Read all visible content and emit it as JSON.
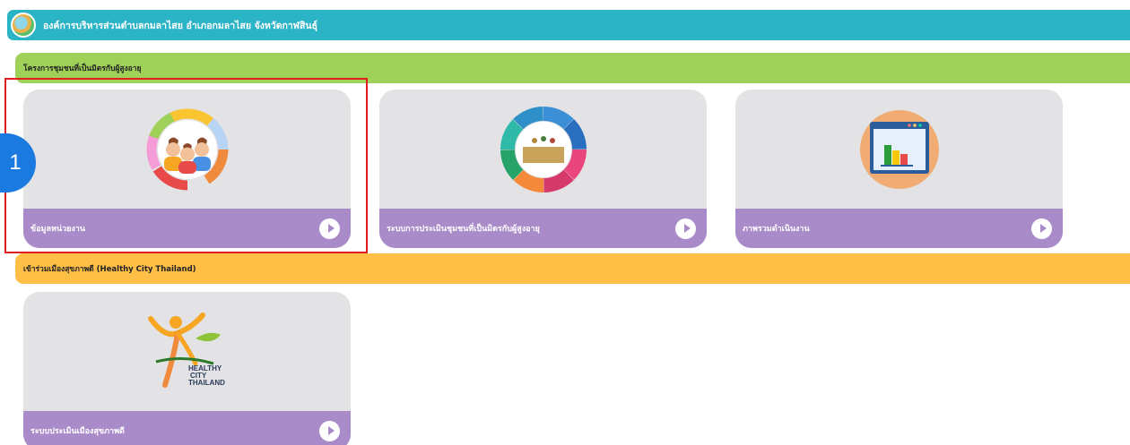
{
  "header": {
    "logo_icon": "municipality-seal-icon",
    "title": "องค์การบริหารส่วนตำบลกมลาไสย อำเภอกมลาไสย จังหวัดกาฬสินธุ์"
  },
  "sections": [
    {
      "title": "โครงการชุมชนที่เป็นมิตรกับผู้สูงอายุ",
      "color": "#9fd159",
      "cards": [
        {
          "label": "ข้อมูลหน่วยงาน",
          "icon": "people-group-icon"
        },
        {
          "label": "ระบบการประเมินชุมชนที่เป็นมิตรกับผู้สูงอายุ",
          "icon": "assessment-wheel-icon"
        },
        {
          "label": "ภาพรวมดำเนินงาน",
          "icon": "bar-chart-window-icon"
        }
      ]
    },
    {
      "title": "เข้าร่วมเมืองสุขภาพดี (Healthy City Thailand)",
      "color": "#ffbf47",
      "cards": [
        {
          "label": "ระบบประเมินเมืองสุขภาพดี",
          "icon": "healthy-city-logo-icon",
          "logo_text": [
            "HEALTHY",
            "CITY",
            "THAILAND"
          ]
        }
      ]
    }
  ],
  "annotation": {
    "badge_number": "1",
    "color": "#e01e1e"
  },
  "colors": {
    "topbar": "#2bb3c6",
    "card_bg": "#e3e3e5",
    "card_footer": "#a98bc9",
    "badge": "#1a7ae0"
  }
}
